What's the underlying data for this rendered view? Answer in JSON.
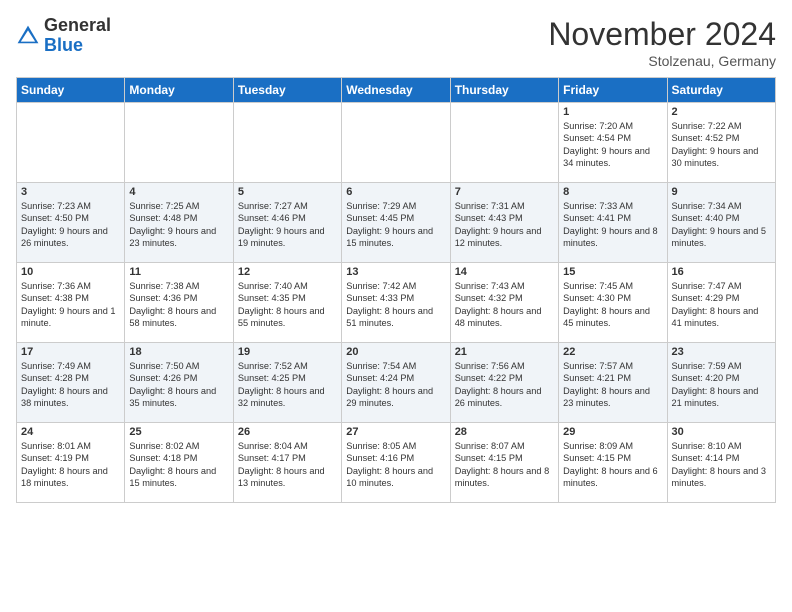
{
  "header": {
    "logo_general": "General",
    "logo_blue": "Blue",
    "month_title": "November 2024",
    "location": "Stolzenau, Germany"
  },
  "weekdays": [
    "Sunday",
    "Monday",
    "Tuesday",
    "Wednesday",
    "Thursday",
    "Friday",
    "Saturday"
  ],
  "weeks": [
    [
      {
        "day": "",
        "info": ""
      },
      {
        "day": "",
        "info": ""
      },
      {
        "day": "",
        "info": ""
      },
      {
        "day": "",
        "info": ""
      },
      {
        "day": "",
        "info": ""
      },
      {
        "day": "1",
        "info": "Sunrise: 7:20 AM\nSunset: 4:54 PM\nDaylight: 9 hours and 34 minutes."
      },
      {
        "day": "2",
        "info": "Sunrise: 7:22 AM\nSunset: 4:52 PM\nDaylight: 9 hours and 30 minutes."
      }
    ],
    [
      {
        "day": "3",
        "info": "Sunrise: 7:23 AM\nSunset: 4:50 PM\nDaylight: 9 hours and 26 minutes."
      },
      {
        "day": "4",
        "info": "Sunrise: 7:25 AM\nSunset: 4:48 PM\nDaylight: 9 hours and 23 minutes."
      },
      {
        "day": "5",
        "info": "Sunrise: 7:27 AM\nSunset: 4:46 PM\nDaylight: 9 hours and 19 minutes."
      },
      {
        "day": "6",
        "info": "Sunrise: 7:29 AM\nSunset: 4:45 PM\nDaylight: 9 hours and 15 minutes."
      },
      {
        "day": "7",
        "info": "Sunrise: 7:31 AM\nSunset: 4:43 PM\nDaylight: 9 hours and 12 minutes."
      },
      {
        "day": "8",
        "info": "Sunrise: 7:33 AM\nSunset: 4:41 PM\nDaylight: 9 hours and 8 minutes."
      },
      {
        "day": "9",
        "info": "Sunrise: 7:34 AM\nSunset: 4:40 PM\nDaylight: 9 hours and 5 minutes."
      }
    ],
    [
      {
        "day": "10",
        "info": "Sunrise: 7:36 AM\nSunset: 4:38 PM\nDaylight: 9 hours and 1 minute."
      },
      {
        "day": "11",
        "info": "Sunrise: 7:38 AM\nSunset: 4:36 PM\nDaylight: 8 hours and 58 minutes."
      },
      {
        "day": "12",
        "info": "Sunrise: 7:40 AM\nSunset: 4:35 PM\nDaylight: 8 hours and 55 minutes."
      },
      {
        "day": "13",
        "info": "Sunrise: 7:42 AM\nSunset: 4:33 PM\nDaylight: 8 hours and 51 minutes."
      },
      {
        "day": "14",
        "info": "Sunrise: 7:43 AM\nSunset: 4:32 PM\nDaylight: 8 hours and 48 minutes."
      },
      {
        "day": "15",
        "info": "Sunrise: 7:45 AM\nSunset: 4:30 PM\nDaylight: 8 hours and 45 minutes."
      },
      {
        "day": "16",
        "info": "Sunrise: 7:47 AM\nSunset: 4:29 PM\nDaylight: 8 hours and 41 minutes."
      }
    ],
    [
      {
        "day": "17",
        "info": "Sunrise: 7:49 AM\nSunset: 4:28 PM\nDaylight: 8 hours and 38 minutes."
      },
      {
        "day": "18",
        "info": "Sunrise: 7:50 AM\nSunset: 4:26 PM\nDaylight: 8 hours and 35 minutes."
      },
      {
        "day": "19",
        "info": "Sunrise: 7:52 AM\nSunset: 4:25 PM\nDaylight: 8 hours and 32 minutes."
      },
      {
        "day": "20",
        "info": "Sunrise: 7:54 AM\nSunset: 4:24 PM\nDaylight: 8 hours and 29 minutes."
      },
      {
        "day": "21",
        "info": "Sunrise: 7:56 AM\nSunset: 4:22 PM\nDaylight: 8 hours and 26 minutes."
      },
      {
        "day": "22",
        "info": "Sunrise: 7:57 AM\nSunset: 4:21 PM\nDaylight: 8 hours and 23 minutes."
      },
      {
        "day": "23",
        "info": "Sunrise: 7:59 AM\nSunset: 4:20 PM\nDaylight: 8 hours and 21 minutes."
      }
    ],
    [
      {
        "day": "24",
        "info": "Sunrise: 8:01 AM\nSunset: 4:19 PM\nDaylight: 8 hours and 18 minutes."
      },
      {
        "day": "25",
        "info": "Sunrise: 8:02 AM\nSunset: 4:18 PM\nDaylight: 8 hours and 15 minutes."
      },
      {
        "day": "26",
        "info": "Sunrise: 8:04 AM\nSunset: 4:17 PM\nDaylight: 8 hours and 13 minutes."
      },
      {
        "day": "27",
        "info": "Sunrise: 8:05 AM\nSunset: 4:16 PM\nDaylight: 8 hours and 10 minutes."
      },
      {
        "day": "28",
        "info": "Sunrise: 8:07 AM\nSunset: 4:15 PM\nDaylight: 8 hours and 8 minutes."
      },
      {
        "day": "29",
        "info": "Sunrise: 8:09 AM\nSunset: 4:15 PM\nDaylight: 8 hours and 6 minutes."
      },
      {
        "day": "30",
        "info": "Sunrise: 8:10 AM\nSunset: 4:14 PM\nDaylight: 8 hours and 3 minutes."
      }
    ]
  ]
}
